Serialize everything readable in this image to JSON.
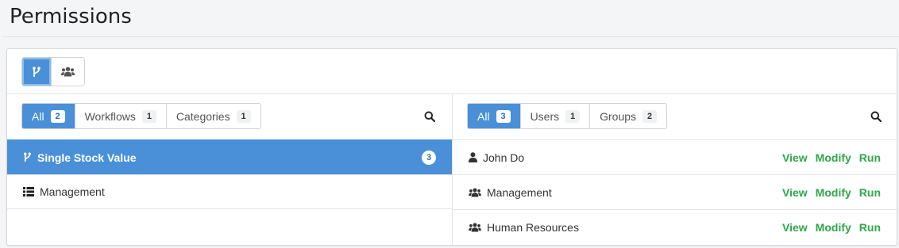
{
  "page": {
    "title": "Permissions"
  },
  "left": {
    "filters": [
      {
        "label": "All",
        "count": "2"
      },
      {
        "label": "Workflows",
        "count": "1"
      },
      {
        "label": "Categories",
        "count": "1"
      }
    ],
    "items": [
      {
        "label": "Single Stock Value",
        "count": "3",
        "icon": "workflow-icon"
      },
      {
        "label": "Management",
        "icon": "category-list-icon"
      }
    ]
  },
  "right": {
    "filters": [
      {
        "label": "All",
        "count": "3"
      },
      {
        "label": "Users",
        "count": "1"
      },
      {
        "label": "Groups",
        "count": "2"
      }
    ],
    "items": [
      {
        "label": "John Do",
        "icon": "user-icon",
        "view": "View",
        "modify": "Modify",
        "run": "Run"
      },
      {
        "label": "Management",
        "icon": "group-icon",
        "view": "View",
        "modify": "Modify",
        "run": "Run"
      },
      {
        "label": "Human Resources",
        "icon": "group-icon",
        "view": "View",
        "modify": "Modify",
        "run": "Run"
      }
    ]
  },
  "colors": {
    "accent": "#4a90d9",
    "permission": "#2ea84a"
  }
}
